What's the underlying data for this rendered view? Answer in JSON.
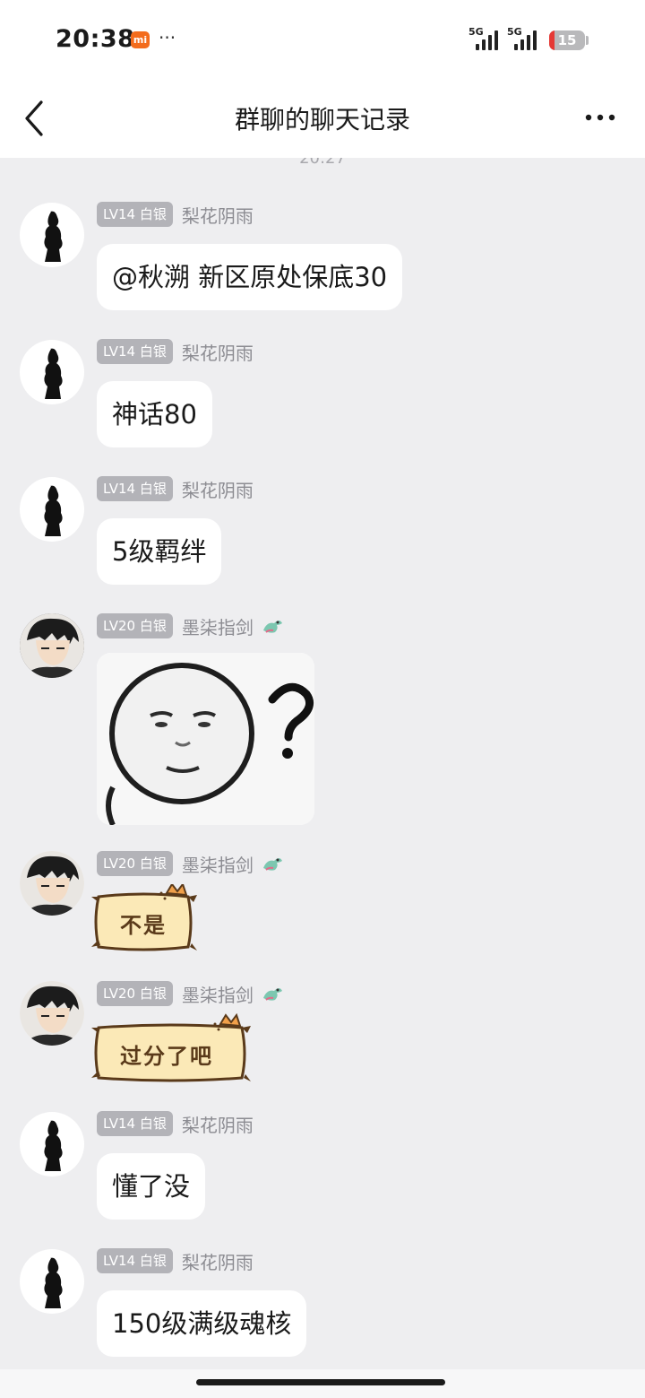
{
  "status_bar": {
    "time": "20:38",
    "mi_label": "mi",
    "extra": "···",
    "signal_1": "5G",
    "signal_2": "5G",
    "battery": "15",
    "battery_level": 0.15
  },
  "header": {
    "title": "群聊的聊天记录",
    "back_icon": "chevron-left-icon",
    "more_icon": "more-horizontal-icon"
  },
  "timestamp_peek": "20:27",
  "messages": [
    {
      "level": "LV14 白银",
      "sender": "梨花阴雨",
      "text": "@秋溯 新区原处保底30"
    },
    {
      "level": "LV14 白银",
      "sender": "梨花阴雨",
      "text": "神话80"
    },
    {
      "level": "LV14 白银",
      "sender": "梨花阴雨",
      "text": "5级羁绊"
    },
    {
      "level": "LV20 白银",
      "sender": "墨柒指剑",
      "sticker": "question-face-sticker"
    },
    {
      "level": "LV20 白银",
      "sender": "墨柒指剑",
      "sticker_text": "不是"
    },
    {
      "level": "LV20 白银",
      "sender": "墨柒指剑",
      "sticker_text": "过分了吧"
    },
    {
      "level": "LV14 白银",
      "sender": "梨花阴雨",
      "text": "懂了没"
    },
    {
      "level": "LV14 白银",
      "sender": "梨花阴雨",
      "text": "150级满级魂核"
    }
  ],
  "colors": {
    "background": "#eeeef0",
    "bubble": "#ffffff",
    "badge": "#b3b3b8",
    "sender": "#8c8c92",
    "battery_low": "#e53935",
    "mi_brand": "#f36c1d"
  }
}
